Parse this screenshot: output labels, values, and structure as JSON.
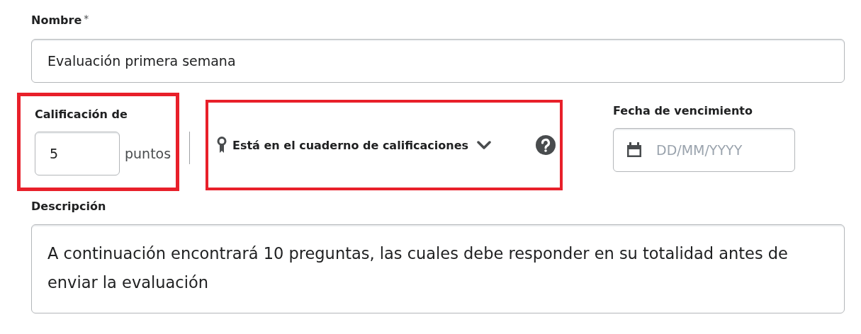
{
  "name": {
    "label": "Nombre",
    "required_mark": "*",
    "value": "Evaluación primera semana"
  },
  "grade": {
    "label": "Calificación de",
    "value": "5",
    "unit": "puntos",
    "highlighted": true
  },
  "gradebook": {
    "label": "Está en el cuaderno de calificaciones",
    "highlighted": true
  },
  "due_date": {
    "label": "Fecha de vencimiento",
    "placeholder": "DD/MM/YYYY"
  },
  "description": {
    "label": "Descripción",
    "value": "A continuación encontrará 10 preguntas, las cuales debe responder en su totalidad antes de enviar la evaluación"
  }
}
